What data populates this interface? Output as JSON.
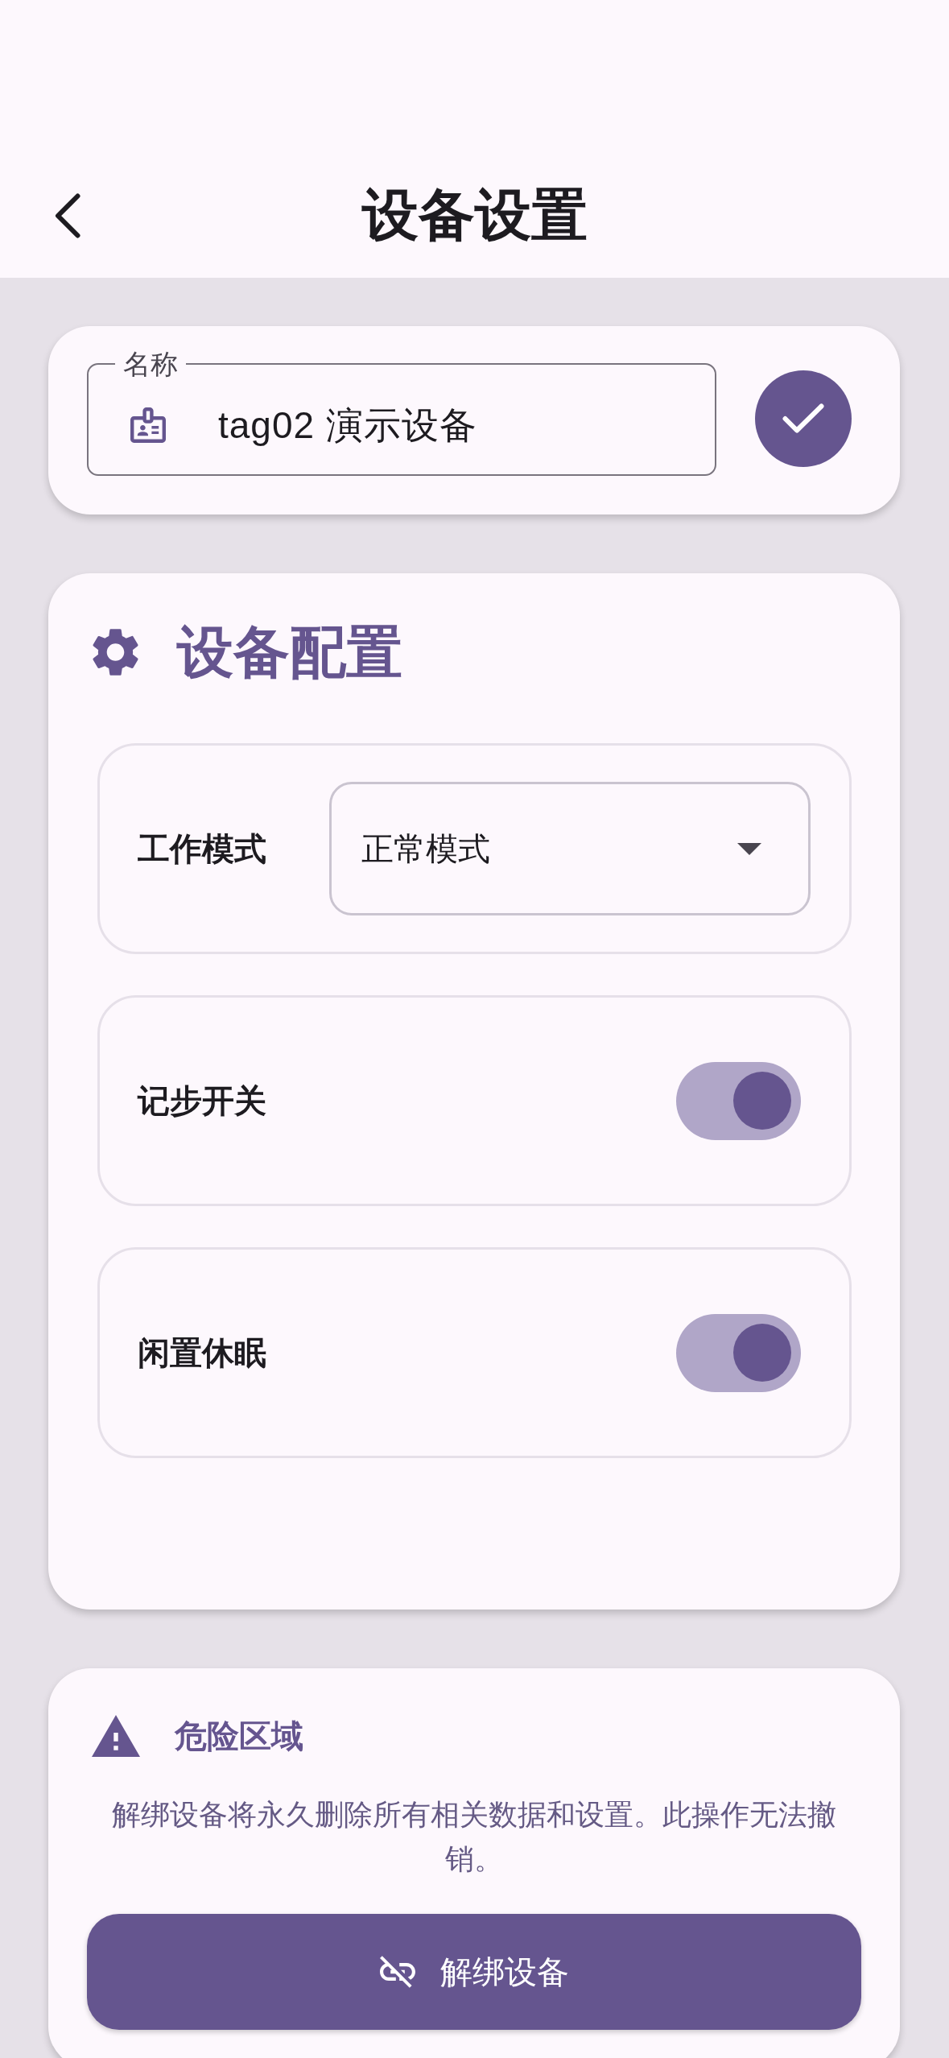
{
  "header": {
    "title": "设备设置"
  },
  "name_card": {
    "field": {
      "label": "名称",
      "value": "tag02 演示设备"
    }
  },
  "config_card": {
    "title": "设备配置",
    "settings": [
      {
        "kind": "dropdown",
        "label": "工作模式",
        "value": "正常模式"
      },
      {
        "kind": "switch",
        "label": "记步开关",
        "on": true
      },
      {
        "kind": "switch",
        "label": "闲置休眠",
        "on": true
      }
    ]
  },
  "danger_zone": {
    "title": "危险区域",
    "description": "解绑设备将永久删除所有相关数据和设置。此操作无法撤销。",
    "button": "解绑设备"
  }
}
